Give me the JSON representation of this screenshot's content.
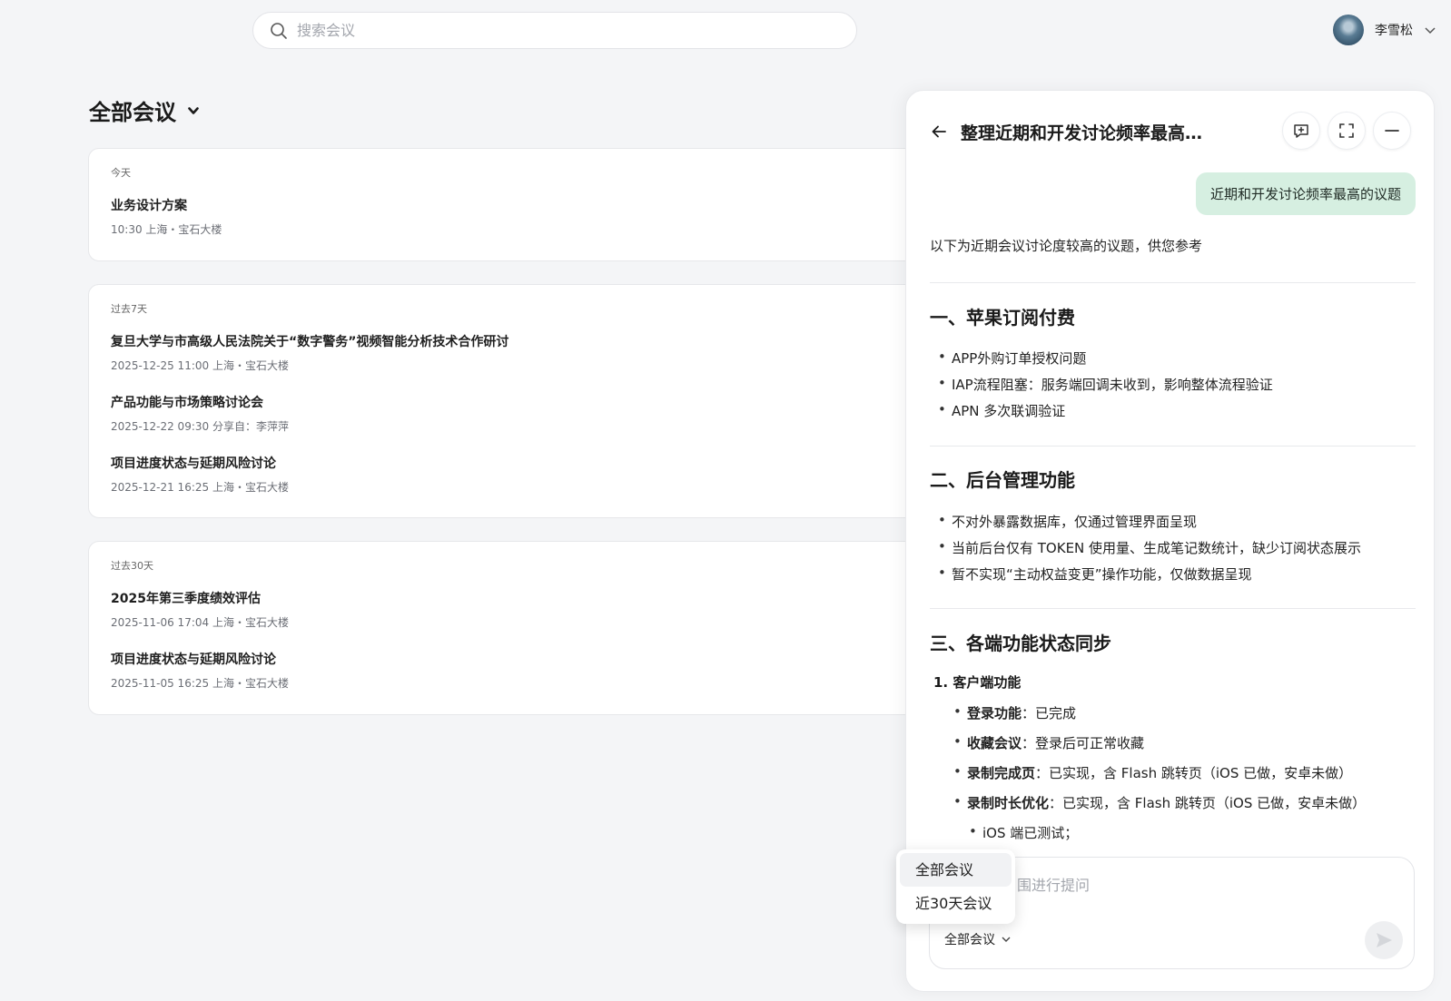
{
  "search": {
    "placeholder": "搜索会议"
  },
  "user": {
    "name": "李雪松"
  },
  "page": {
    "title": "全部会议"
  },
  "groups": [
    {
      "label": "今天",
      "meetings": [
        {
          "title": "业务设计方案",
          "meta": "10:30  上海・宝石大楼"
        }
      ]
    },
    {
      "label": "过去7天",
      "meetings": [
        {
          "title": "复旦大学与市高级人民法院关于“数字警务”视频智能分析技术合作研讨",
          "meta": "2025-12-25  11:00  上海・宝石大楼"
        },
        {
          "title": "产品功能与市场策略讨论会",
          "meta": "2025-12-22  09:30   分享自：李萍萍"
        },
        {
          "title": "项目进度状态与延期风险讨论",
          "meta": "2025-12-21  16:25  上海・宝石大楼"
        }
      ]
    },
    {
      "label": "过去30天",
      "meetings": [
        {
          "title": "2025年第三季度绩效评估",
          "meta": "2025-11-06  17:04  上海・宝石大楼"
        },
        {
          "title": "项目进度状态与延期风险讨论",
          "meta": "2025-11-05  16:25  上海・宝石大楼"
        }
      ]
    }
  ],
  "panel": {
    "title": "整理近期和开发讨论频率最高…",
    "user_message": "近期和开发讨论频率最高的议题",
    "intro": "以下为近期会议讨论度较高的议题，供您参考",
    "sections": [
      {
        "title": "一、苹果订阅付费",
        "items": [
          "APP外购订单授权问题",
          "IAP流程阻塞：服务端回调未收到，影响整体流程验证",
          "APN 多次联调验证"
        ]
      },
      {
        "title": "二、后台管理功能",
        "items": [
          "不对外暴露数据库，仅通过管理界面呈现",
          "当前后台仅有 TOKEN 使用量、生成笔记数统计，缺少订阅状态展示",
          "暂不实现“主动权益变更”操作功能，仅做数据呈现"
        ]
      },
      {
        "title": "三、各端功能状态同步"
      }
    ],
    "sub_heading": "1. 客户端功能",
    "features": [
      {
        "key": "登录功能",
        "value": "：已完成"
      },
      {
        "key": "收藏会议",
        "value": "：登录后可正常收藏"
      },
      {
        "key": "录制完成页",
        "value": "：已实现，含 Flash 跳转页（iOS 已做，安卓未做）"
      },
      {
        "key": "录制时长优化",
        "value": "：已实现，含 Flash 跳转页（iOS 已做，安卓未做）"
      }
    ],
    "nested_item": "iOS 端已测试；",
    "composer_placeholder": "围进行提问",
    "scope_label": "全部会议"
  },
  "dropdown": {
    "options": [
      "全部会议",
      "近30天会议"
    ]
  }
}
